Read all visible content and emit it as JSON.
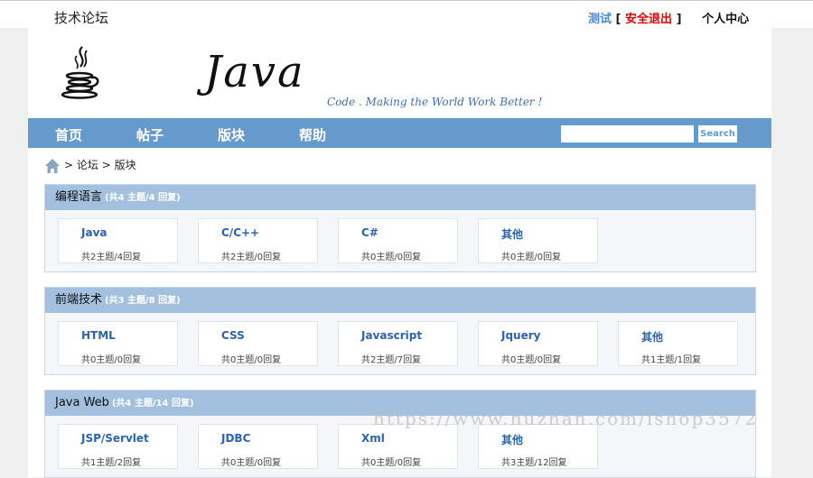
{
  "header": {
    "site_title": "技术论坛",
    "username": "测试",
    "bracket_open": "[",
    "logout": "安全退出",
    "bracket_close": "]",
    "user_center": "个人中心"
  },
  "banner": {
    "logo_text": "Java",
    "slogan": "Code . Making the World Work Better !"
  },
  "nav": {
    "items": [
      "首页",
      "帖子",
      "版块",
      "帮助"
    ],
    "search_placeholder": "",
    "search_button": "Search"
  },
  "breadcrumb": {
    "sep1": ">",
    "forum": "论坛",
    "sep2": ">",
    "current": "版块"
  },
  "sections": [
    {
      "title": "编程语言",
      "stats": "(共4 主题/4 回复)",
      "boards": [
        {
          "name": "Java",
          "stats": "共2主题/4回复"
        },
        {
          "name": "C/C++",
          "stats": "共2主题/0回复"
        },
        {
          "name": "C#",
          "stats": "共0主题/0回复"
        },
        {
          "name": "其他",
          "stats": "共0主题/0回复"
        }
      ]
    },
    {
      "title": "前端技术",
      "stats": "(共3 主题/8 回复)",
      "boards": [
        {
          "name": "HTML",
          "stats": "共0主题/0回复"
        },
        {
          "name": "CSS",
          "stats": "共0主题/0回复"
        },
        {
          "name": "Javascript",
          "stats": "共2主题/7回复"
        },
        {
          "name": "Jquery",
          "stats": "共0主题/0回复"
        },
        {
          "name": "其他",
          "stats": "共1主题/1回复"
        }
      ]
    },
    {
      "title": "Java Web",
      "stats": "(共4 主题/14 回复)",
      "boards": [
        {
          "name": "JSP/Servlet",
          "stats": "共1主题/2回复"
        },
        {
          "name": "JDBC",
          "stats": "共0主题/0回复"
        },
        {
          "name": "Xml",
          "stats": "共0主题/0回复"
        },
        {
          "name": "其他",
          "stats": "共3主题/12回复"
        }
      ]
    }
  ],
  "watermark": "https://www.huzhan.com/ishop3572",
  "colors": {
    "nav_bg": "#6699cc",
    "section_header": "#a3c1df",
    "board_link": "#2a63b0",
    "logout": "#e00000",
    "username": "#4a8bd6"
  }
}
